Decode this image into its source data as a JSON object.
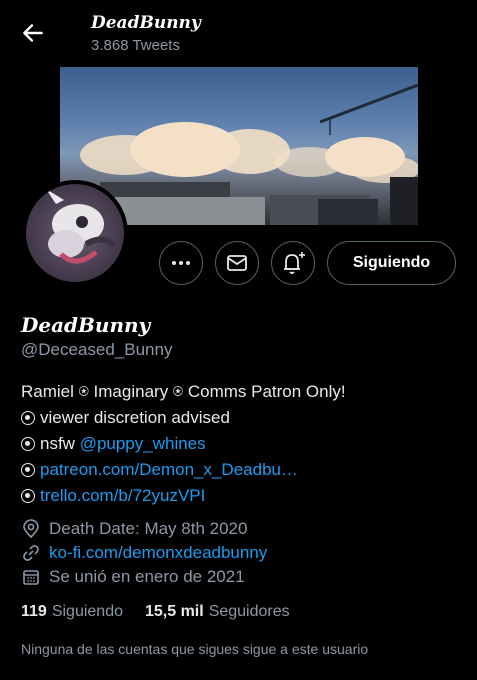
{
  "header": {
    "display_name": "DeadBunny",
    "tweet_count": "3.868 Tweets"
  },
  "profile": {
    "display_name": "DeadBunny",
    "handle": "@Deceased_Bunny",
    "follow_button": "Siguiendo",
    "bio": {
      "line1": "Ramiel ⍟ Imaginary ⍟ Comms Patron Only!",
      "line2": "viewer discretion advised",
      "line3_prefix": "nsfw ",
      "line3_link": "@puppy_whines",
      "line4_link": "patreon.com/Demon_x_Deadbu…",
      "line5_link": "trello.com/b/72yuzVPI"
    },
    "location": "Death Date: May 8th 2020",
    "website": "ko-fi.com/demonxdeadbunny",
    "joined": "Se unió en enero de 2021",
    "following_count": "119",
    "following_label": "Siguiendo",
    "followers_count": "15,5 mil",
    "followers_label": "Seguidores",
    "known_followers": "Ninguna de las cuentas que sigues sigue a este usuario"
  },
  "colors": {
    "background": "#000000",
    "link": "#1d9bf0",
    "secondary_text": "#8b98a5",
    "border": "#536471"
  }
}
